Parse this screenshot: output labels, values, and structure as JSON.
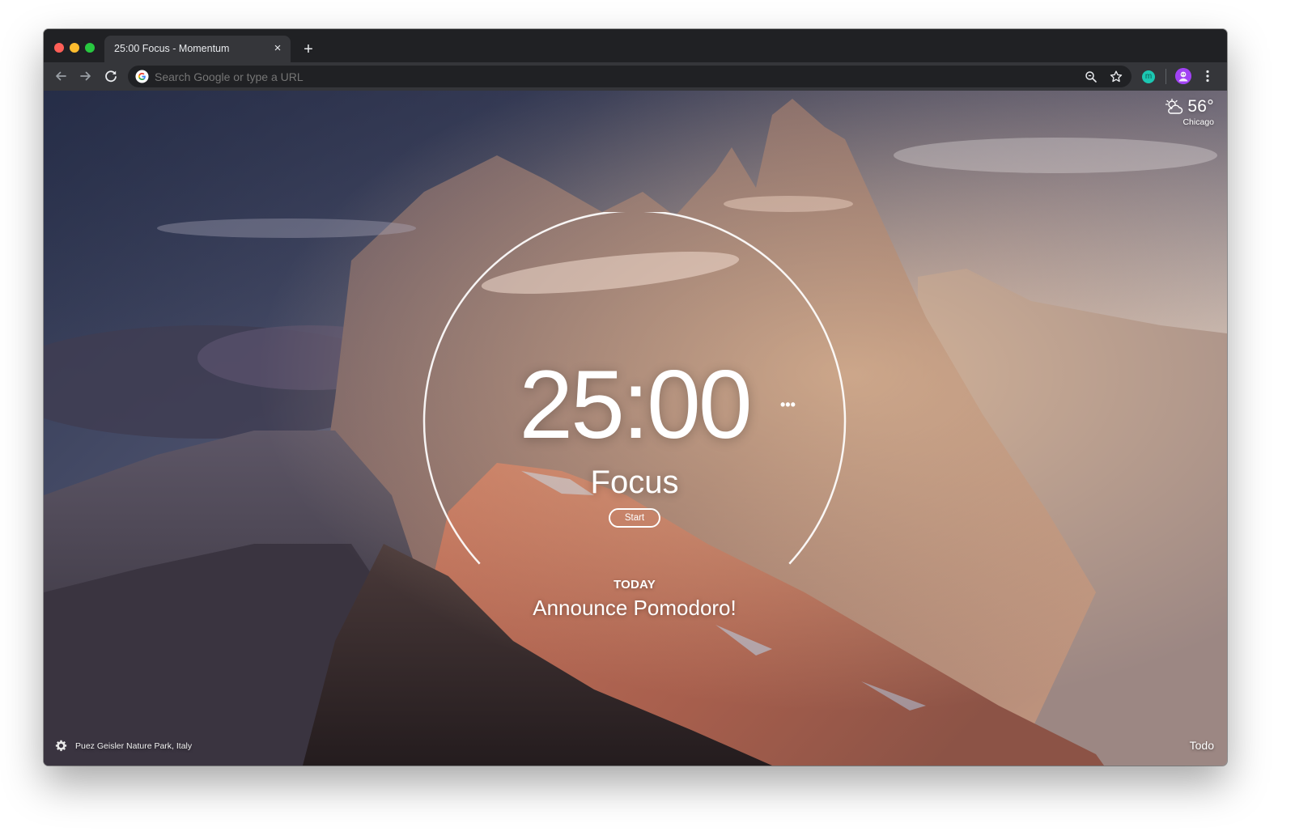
{
  "browser": {
    "tab_title": "25:00 Focus - Momentum",
    "tab_close_glyph": "×",
    "new_tab_glyph": "+",
    "omnibox_placeholder": "Search Google or type a URL",
    "extension_letter": "m"
  },
  "weather": {
    "temperature": "56°",
    "location": "Chicago",
    "icon": "partly-cloudy-icon"
  },
  "focus": {
    "timer": "25:00",
    "more_glyph": "•••",
    "mode": "Focus",
    "start_label": "Start"
  },
  "today": {
    "label": "TODAY",
    "task": "Announce Pomodoro!"
  },
  "footer": {
    "photo_location": "Puez Geisler Nature Park, Italy",
    "todo_label": "Todo"
  },
  "colors": {
    "tab_strip": "#202124",
    "toolbar": "#35363a",
    "traffic_red": "#ff5f57",
    "traffic_yellow": "#febc2e",
    "traffic_green": "#28c840",
    "extension_teal": "#1cc7b2",
    "avatar_purple": "#a142f4"
  }
}
